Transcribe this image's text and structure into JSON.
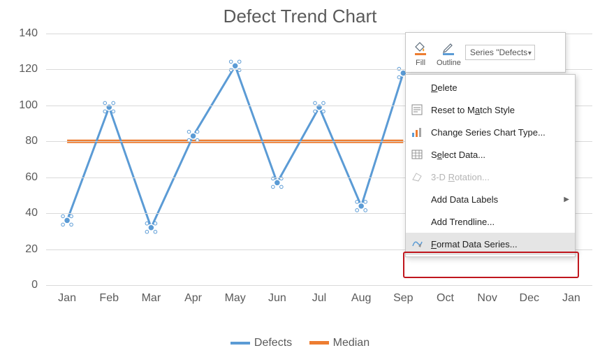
{
  "chart_data": {
    "type": "line",
    "title": "Defect Trend Chart",
    "xlabel": "",
    "ylabel": "",
    "categories": [
      "Jan",
      "Feb",
      "Mar",
      "Apr",
      "May",
      "Jun",
      "Jul",
      "Aug",
      "Sep",
      "Oct",
      "Nov",
      "Dec",
      "Jan"
    ],
    "series": [
      {
        "name": "Defects",
        "values": [
          36,
          99,
          32,
          83,
          122,
          57,
          99,
          44,
          118,
          null,
          null,
          null,
          null
        ],
        "color": "#5b9bd5"
      },
      {
        "name": "Median",
        "values": [
          80,
          80,
          80,
          80,
          80,
          80,
          80,
          80,
          80,
          null,
          null,
          null,
          null
        ],
        "color": "#ed7d31"
      }
    ],
    "ylim": [
      0,
      140
    ],
    "yticks": [
      0,
      20,
      40,
      60,
      80,
      100,
      120,
      140
    ],
    "grid": true,
    "legend_position": "bottom"
  },
  "legend": {
    "items": [
      "Defects",
      "Median"
    ]
  },
  "mini_toolbar": {
    "fill_label": "Fill",
    "outline_label": "Outline",
    "series_selector": "Series \"Defects"
  },
  "context_menu": {
    "items": [
      {
        "label": "Delete",
        "accel": "D"
      },
      {
        "label": "Reset to Match Style",
        "accel": "a"
      },
      {
        "label": "Change Series Chart Type...",
        "accel": "Y"
      },
      {
        "label": "Select Data...",
        "accel": "e"
      },
      {
        "label": "3-D Rotation...",
        "accel": "R",
        "disabled": true
      },
      {
        "label": "Add Data Labels",
        "accel": "B",
        "submenu": true
      },
      {
        "label": "Add Trendline...",
        "accel": "R"
      },
      {
        "label": "Format Data Series...",
        "accel": "F",
        "hover": true
      }
    ]
  }
}
